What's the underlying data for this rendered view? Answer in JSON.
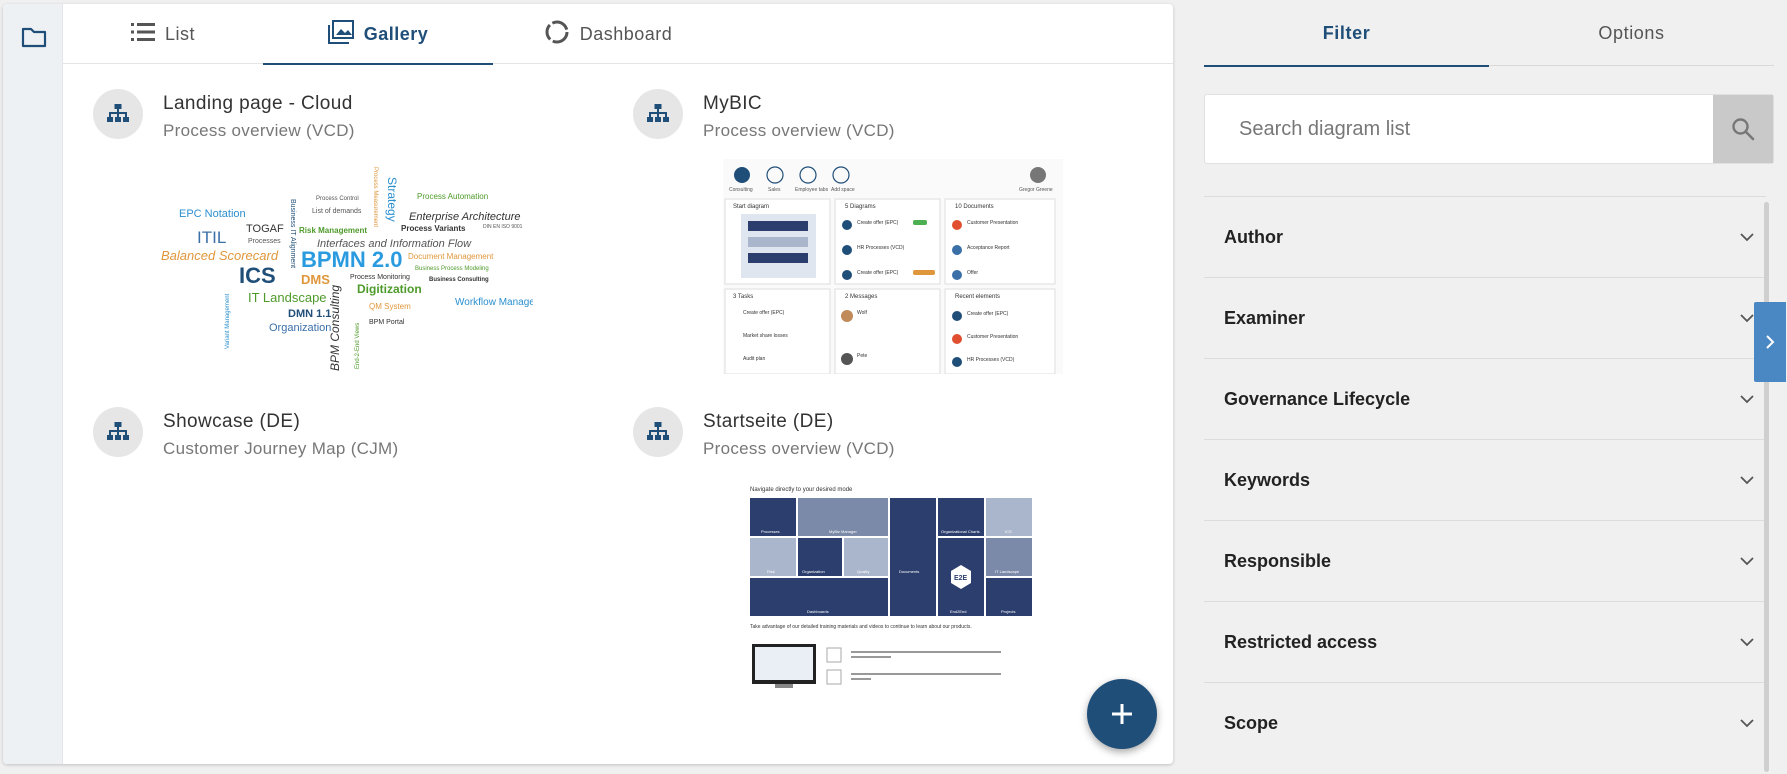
{
  "view_tabs": [
    {
      "label": "List",
      "icon": "list-icon"
    },
    {
      "label": "Gallery",
      "icon": "gallery-icon"
    },
    {
      "label": "Dashboard",
      "icon": "dashboard-icon"
    }
  ],
  "cards": [
    {
      "title": "Landing page - Cloud",
      "subtitle": "Process overview (VCD)"
    },
    {
      "title": "MyBIC",
      "subtitle": "Process overview (VCD)"
    },
    {
      "title": "Showcase (DE)",
      "subtitle": "Customer Journey Map (CJM)"
    },
    {
      "title": "Startseite (DE)",
      "subtitle": "Process overview (VCD)"
    }
  ],
  "wordcloud": {
    "words": [
      "EPC Notation",
      "ITIL",
      "TOGAF",
      "Processes",
      "Balanced Scorecard",
      "ICS",
      "BPMN 2.0",
      "DMS",
      "IT Landscape",
      "DMN 1.1",
      "Organization",
      "Risk Management",
      "Interfaces and Information Flow",
      "Enterprise Architecture",
      "Process Automation",
      "Process Variants",
      "Process Control",
      "List of demands",
      "Digitization",
      "Process Monitoring",
      "Document Management",
      "Business Process Modeling",
      "Business Consulting",
      "Workflow Management",
      "QM System",
      "BPM Portal",
      "BPM Consulting",
      "Strategy",
      "Business IT Alignment",
      "End-2-End Views",
      "Process Measurement",
      "Variant Management",
      "DIN EN ISO 9001"
    ]
  },
  "mybic_preview": {
    "top_icons": [
      "Consulting",
      "Sales",
      "Employee tabs",
      "Add space"
    ],
    "user": "Gregor Greene",
    "panels": [
      {
        "title": "Start diagram",
        "items": []
      },
      {
        "title": "5 Diagrams",
        "items": [
          "Create offer (EPC)",
          "HR Processes (VCD)",
          "Create offer (EPC)"
        ]
      },
      {
        "title": "10 Documents",
        "items": [
          "Customer Presentation",
          "Acceptance Report",
          "Offer"
        ]
      },
      {
        "title": "3 Tasks",
        "items": [
          "Create offer (EPC)",
          "Market share losses",
          "Audit plan"
        ]
      },
      {
        "title": "2 Messages",
        "items": [
          "Wolf",
          "Pete"
        ]
      },
      {
        "title": "Recent elements",
        "items": [
          "Create offer (EPC)",
          "Customer Presentation",
          "HR Processes (VCD)"
        ]
      }
    ]
  },
  "startseite_preview": {
    "heading": "Navigate directly to your desired mode",
    "tiles": [
      "Processes",
      "MyBiz Manager",
      "Documents",
      "Organizational Charts",
      "ICS",
      "Risk",
      "Organization",
      "Quality",
      "E2E",
      "IT Landscape",
      "Dashboards",
      "End2End",
      "Projects"
    ],
    "footer_text": "Take advantage of our detailed training materials and videos to continue to learn about our products."
  },
  "fab": {
    "label": "+"
  },
  "side_tabs": [
    "Filter",
    "Options"
  ],
  "search": {
    "placeholder": "Search diagram list"
  },
  "filters": [
    "Author",
    "Examiner",
    "Governance Lifecycle",
    "Keywords",
    "Responsible",
    "Restricted access",
    "Scope"
  ],
  "colors": {
    "accent": "#1f4e79",
    "handle": "#4a88c4",
    "tile_dark": "#2c3e6e",
    "tile_light": "#aab6cc"
  }
}
